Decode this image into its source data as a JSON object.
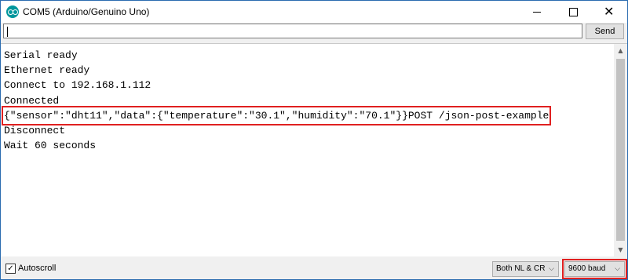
{
  "window": {
    "title": "COM5 (Arduino/Genuino Uno)",
    "icon": "arduino-logo-icon",
    "controls": {
      "close_glyph": "✕"
    }
  },
  "send": {
    "input_value": "",
    "button_label": "Send"
  },
  "output": {
    "lines": [
      "Serial ready",
      "Ethernet ready",
      "Connect to 192.168.1.112",
      "Connected",
      "{\"sensor\":\"dht11\",\"data\":{\"temperature\":\"30.1\",\"humidity\":\"70.1\"}}POST /json-post-example",
      "Disconnect",
      "Wait 60 seconds"
    ],
    "highlighted_line_index": 4,
    "highlight_color": "#e02020"
  },
  "scrollbar": {
    "up_glyph": "▲",
    "down_glyph": "▼"
  },
  "bottom": {
    "autoscroll_label": "Autoscroll",
    "autoscroll_checked": true,
    "autoscroll_check_glyph": "✓",
    "line_ending_value": "Both NL & CR",
    "baud_value": "9600 baud",
    "chevron_glyph": "⌵"
  },
  "colors": {
    "accent": "#00979d",
    "highlight": "#e02020"
  }
}
